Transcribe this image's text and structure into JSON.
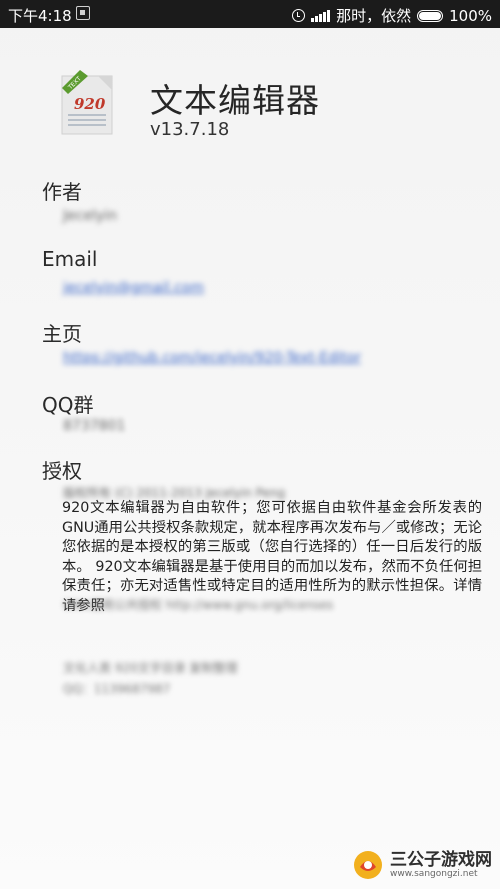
{
  "status_bar": {
    "time": "下午4:18",
    "carrier": "那时，依然",
    "battery": "100%"
  },
  "app": {
    "name": "文本编辑器",
    "version": "v13.7.18",
    "logo_badge": "TEXT",
    "logo_number": "920"
  },
  "author": {
    "label": "作者",
    "value": "Jecelyin"
  },
  "email": {
    "label": "Email",
    "value": "jecelyin@gmail.com"
  },
  "homepage": {
    "label": "主页",
    "value": "https://github.com/jecelyin/920-Text-Editor"
  },
  "qq_group": {
    "label": "QQ群",
    "value": "8737801"
  },
  "license": {
    "label": "授权",
    "copyright_line": "版权所有 (C) 2011-2013 Jecelyin Peng",
    "body": " 920文本编辑器为自由软件；您可依据自由软件基金会所发表的GNU通用公共授权条款规定，就本程序再次发布与／或修改；无论您依据的是本授权的第三版或（您自行选择的）任一日后发行的版本。 920文本编辑器是基于使用目的而加以发布，然而不负任何担保责任；亦无对适售性或特定目的适用性所为的默示性担保。详情请参照",
    "license_ref": "GNU通用公共授权    http://www.gnu.org/licenses",
    "signature_line1": "文化人类    920文字目录 复制整理",
    "signature_line2": "QQ：1139687987"
  },
  "watermark": {
    "name": "三公子游戏网",
    "url": "www.sangongzi.net"
  }
}
